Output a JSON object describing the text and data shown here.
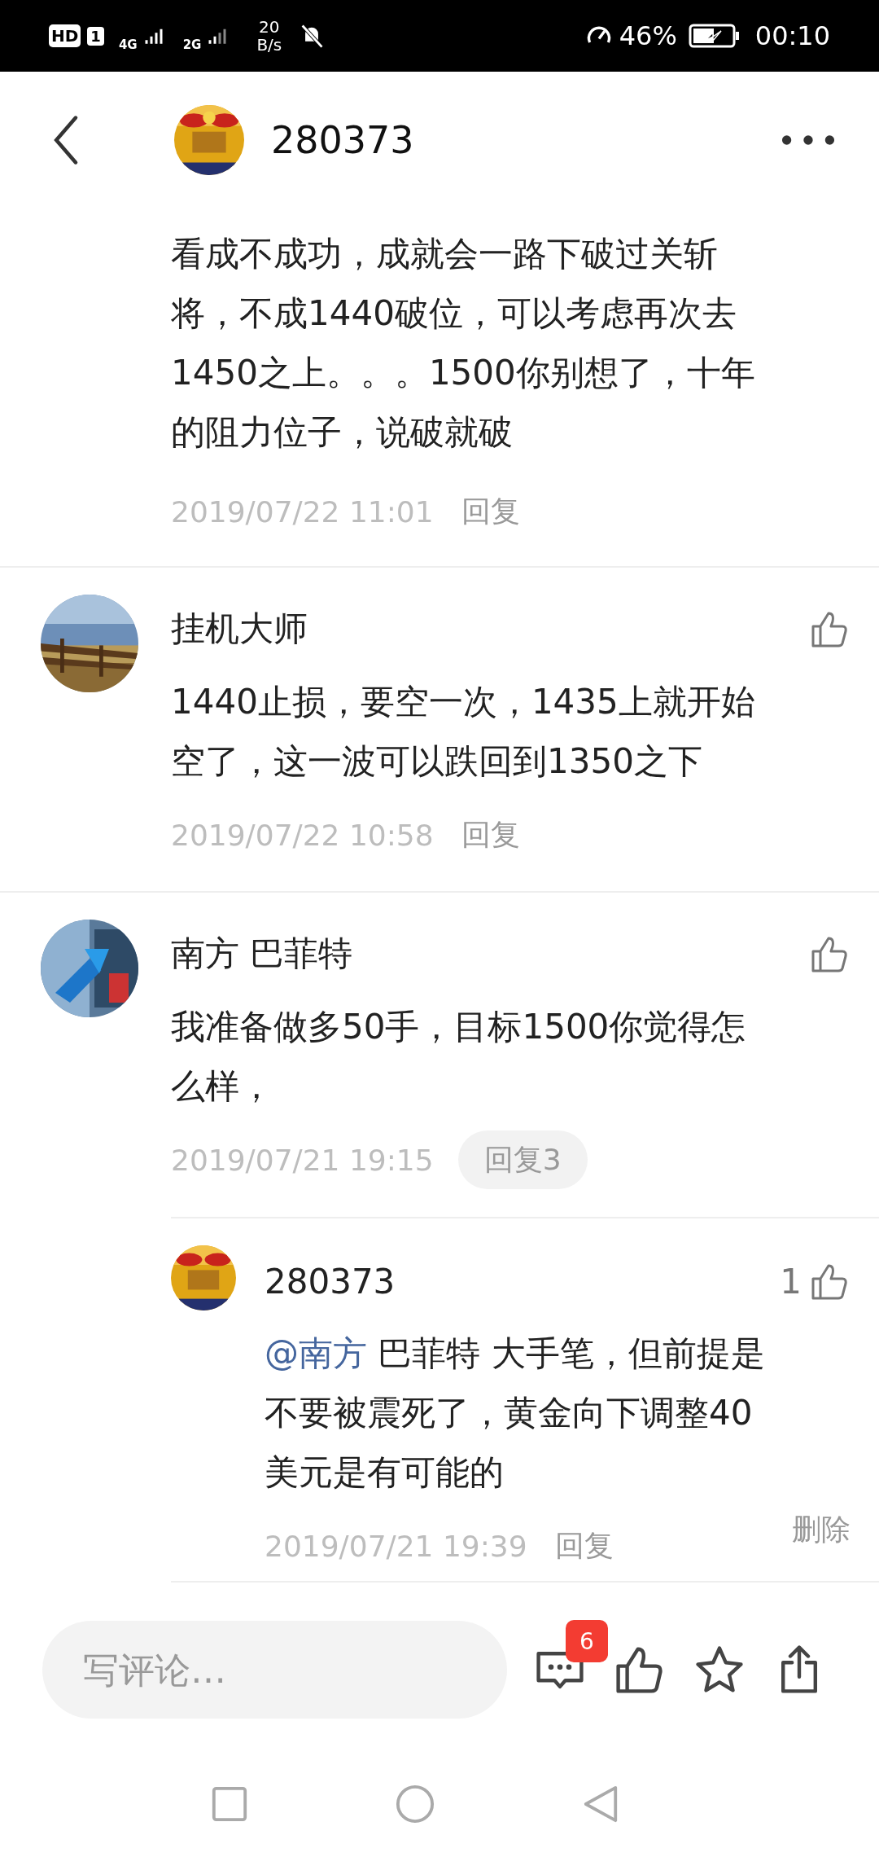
{
  "status_bar": {
    "hd": "HD",
    "sim": "1",
    "net1": "4G",
    "net2": "2G",
    "speed": "20",
    "speed_unit": "B/s",
    "battery": "46%",
    "time": "00:10"
  },
  "header": {
    "title": "280373"
  },
  "comments": [
    {
      "body_lines": [
        "看成不成功，成就会一路下破过关斩",
        "将，不成1440破位，可以考虑再次去",
        "1450之上。。。1500你别想了，十年",
        "的阻力位子，说破就破"
      ],
      "time": "2019/07/22 11:01",
      "reply_label": "回复"
    },
    {
      "author": "挂机大师",
      "body_lines": [
        "1440止损，要空一次，1435上就开始",
        "空了，这一波可以跌回到1350之下"
      ],
      "time": "2019/07/22 10:58",
      "reply_label": "回复"
    },
    {
      "author": "南方 巴菲特",
      "body_lines": [
        "我准备做多50手，目标1500你觉得怎",
        "么样，"
      ],
      "time": "2019/07/21 19:15",
      "reply_label": "回复3",
      "replies": [
        {
          "author": "280373",
          "likes": "1",
          "mention": "@南方",
          "body_lines": [
            " 巴菲特 大手笔，但前提是",
            "不要被震死了，黄金向下调整40",
            "美元是有可能的"
          ],
          "time": "2019/07/21 19:39",
          "reply_label": "回复",
          "delete_label": "删除"
        }
      ]
    }
  ],
  "bottom_bar": {
    "placeholder": "写评论…",
    "comment_count": "6"
  }
}
